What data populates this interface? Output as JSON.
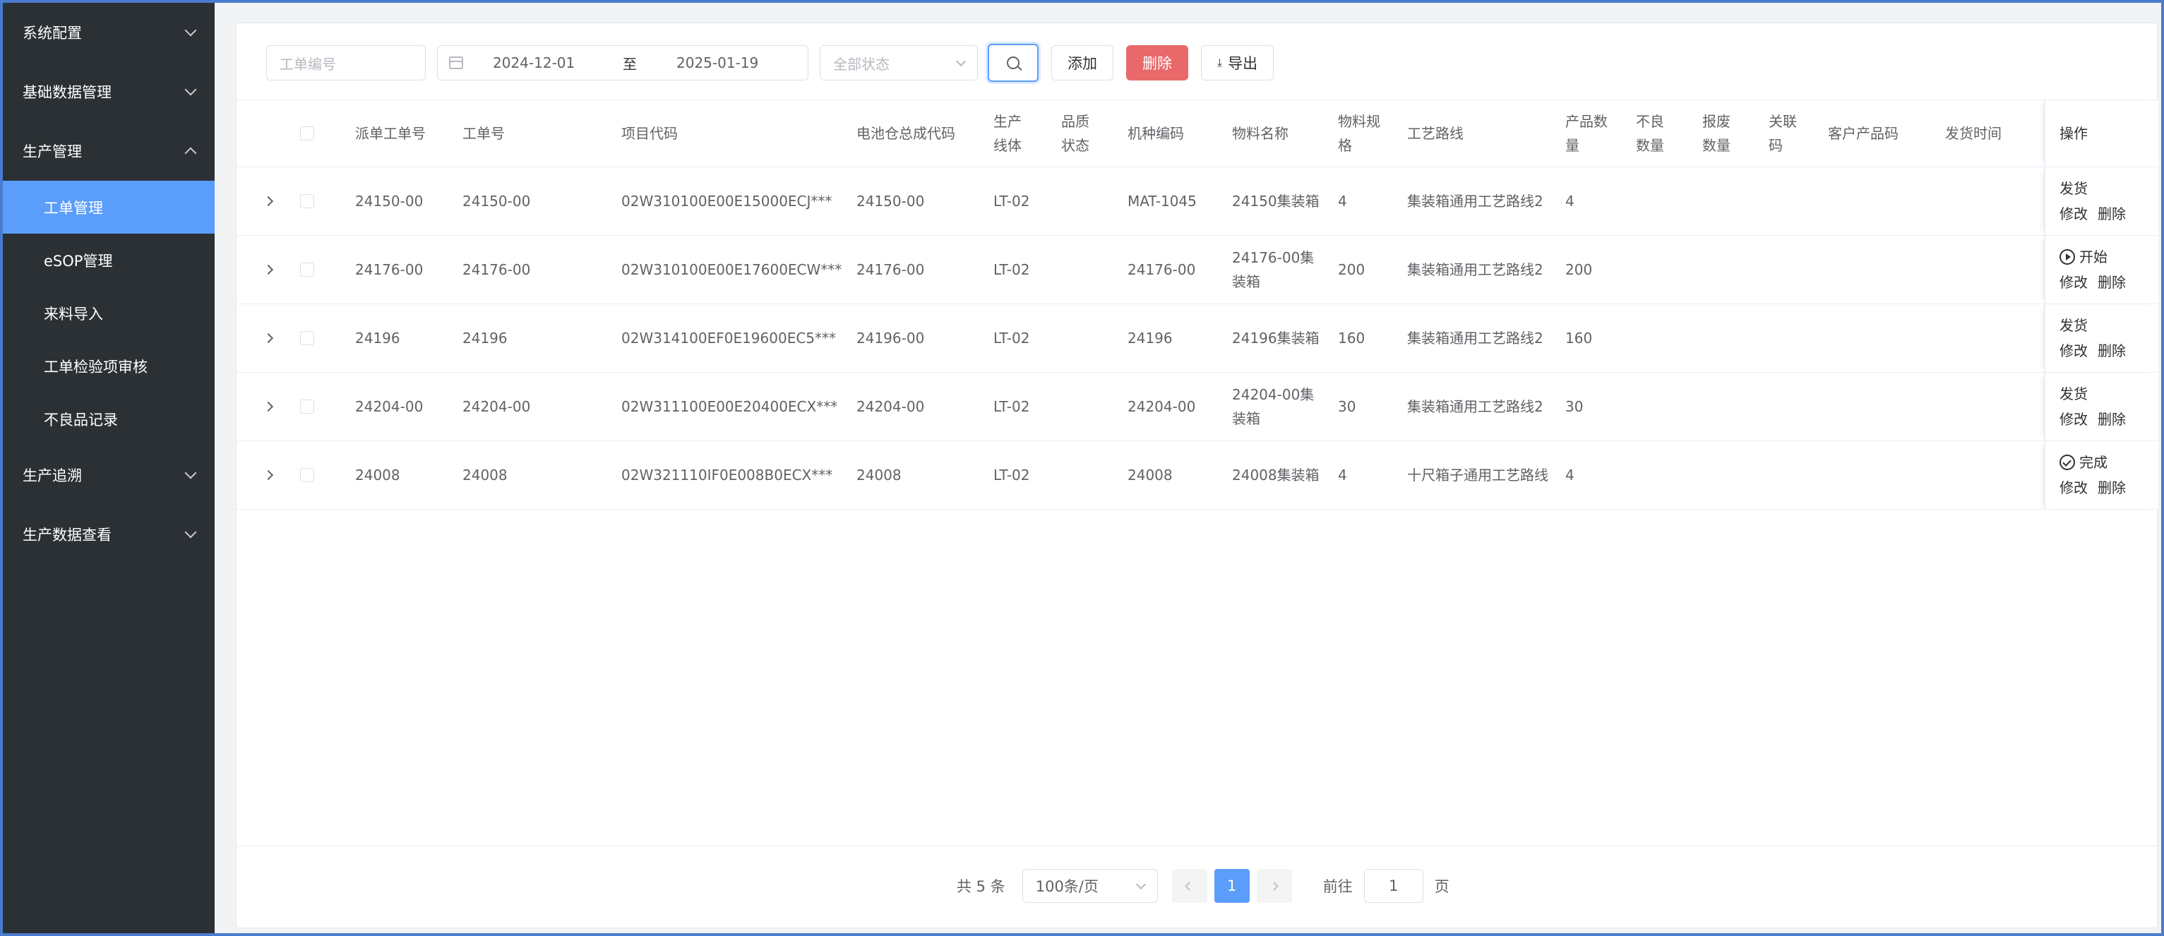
{
  "sidebar": {
    "groups": [
      {
        "label": "系统配置",
        "expanded": false
      },
      {
        "label": "基础数据管理",
        "expanded": false
      },
      {
        "label": "生产管理",
        "expanded": true
      },
      {
        "label": "生产追溯",
        "expanded": false
      },
      {
        "label": "生产数据查看",
        "expanded": false
      }
    ],
    "sub_items": [
      {
        "label": "工单管理",
        "active": true
      },
      {
        "label": "eSOP管理"
      },
      {
        "label": "来料导入"
      },
      {
        "label": "工单检验项审核"
      },
      {
        "label": "不良品记录"
      }
    ]
  },
  "toolbar": {
    "work_order_placeholder": "工单编号",
    "date_start": "2024-12-01",
    "date_separator": "至",
    "date_end": "2025-01-19",
    "status_placeholder": "全部状态",
    "add_label": "添加",
    "delete_label": "删除",
    "export_label": "导出"
  },
  "table": {
    "headers": {
      "dispatch_no": "派单工单号",
      "work_no": "工单号",
      "project_code": "项目代码",
      "battery_code": "电池仓总成代码",
      "line": "生产线体",
      "quality": "品质状态",
      "model_code": "机种编码",
      "material_name": "物料名称",
      "spec": "物料规格",
      "route": "工艺路线",
      "qty": "产品数量",
      "defect": "不良数量",
      "scrap": "报废数量",
      "related": "关联码",
      "customer_code": "客户产品码",
      "ship_time": "发货时间",
      "ops": "操作"
    },
    "rows": [
      {
        "dispatch_no": "24150-00",
        "work_no": "24150-00",
        "project_code": "02W310100E00E15000ECJ***",
        "battery_code": "24150-00",
        "line": "LT-02",
        "quality": "",
        "model_code": "MAT-1045",
        "material_name": "24150集装箱",
        "spec": "4",
        "route": "集装箱通用工艺路线2",
        "qty": "4",
        "op_primary": "发货",
        "op_icon": "",
        "op_edit": "修改",
        "op_delete": "删除"
      },
      {
        "dispatch_no": "24176-00",
        "work_no": "24176-00",
        "project_code": "02W310100E00E17600ECW***",
        "battery_code": "24176-00",
        "line": "LT-02",
        "quality": "",
        "model_code": "24176-00",
        "material_name": "24176-00集装箱",
        "spec": "200",
        "route": "集装箱通用工艺路线2",
        "qty": "200",
        "op_primary": "开始",
        "op_icon": "play-circle-icon",
        "op_edit": "修改",
        "op_delete": "删除"
      },
      {
        "dispatch_no": "24196",
        "work_no": "24196",
        "project_code": "02W314100EF0E19600EC5***",
        "battery_code": "24196-00",
        "line": "LT-02",
        "quality": "",
        "model_code": "24196",
        "material_name": "24196集装箱",
        "spec": "160",
        "route": "集装箱通用工艺路线2",
        "qty": "160",
        "op_primary": "发货",
        "op_icon": "",
        "op_edit": "修改",
        "op_delete": "删除"
      },
      {
        "dispatch_no": "24204-00",
        "work_no": "24204-00",
        "project_code": "02W311100E00E20400ECX***",
        "battery_code": "24204-00",
        "line": "LT-02",
        "quality": "",
        "model_code": "24204-00",
        "material_name": "24204-00集装箱",
        "spec": "30",
        "route": "集装箱通用工艺路线2",
        "qty": "30",
        "op_primary": "发货",
        "op_icon": "",
        "op_edit": "修改",
        "op_delete": "删除"
      },
      {
        "dispatch_no": "24008",
        "work_no": "24008",
        "project_code": "02W321110IF0E008B0ECX***",
        "battery_code": "24008",
        "line": "LT-02",
        "quality": "",
        "model_code": "24008",
        "material_name": "24008集装箱",
        "spec": "4",
        "route": "十尺箱子通用工艺路线",
        "qty": "4",
        "op_primary": "完成",
        "op_icon": "check-circle-icon",
        "op_edit": "修改",
        "op_delete": "删除"
      }
    ]
  },
  "pagination": {
    "total_text": "共 5 条",
    "page_size": "100条/页",
    "current_page": "1",
    "goto_label": "前往",
    "goto_value": "1",
    "page_suffix": "页"
  }
}
